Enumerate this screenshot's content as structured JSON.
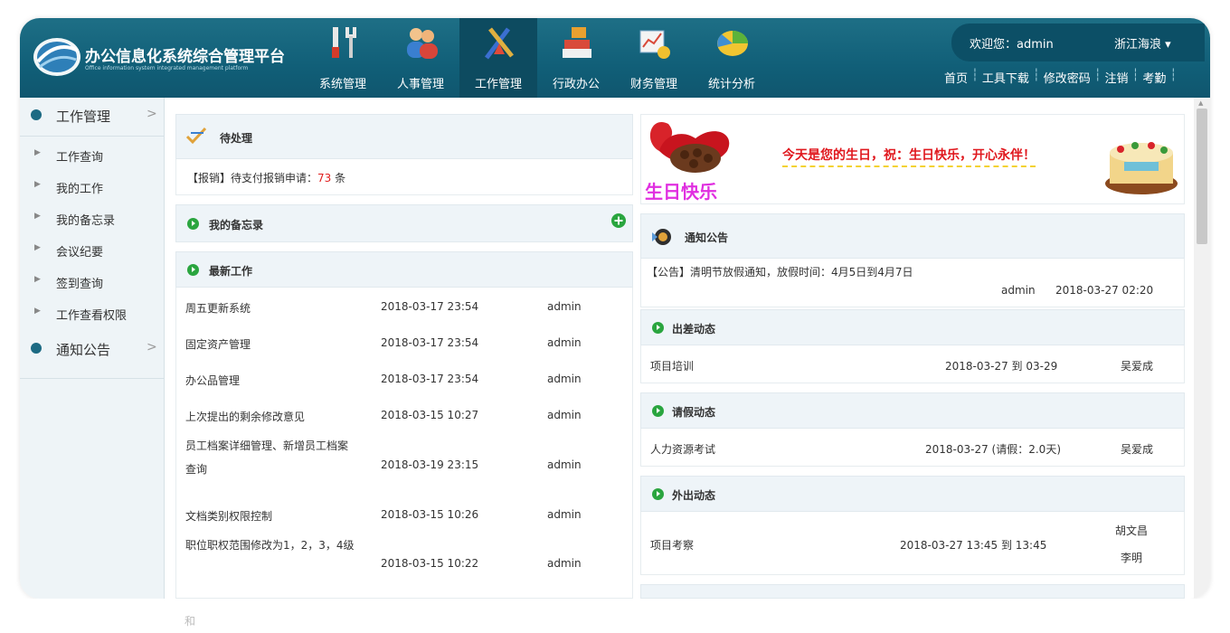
{
  "brand": {
    "title": "办公信息化系统综合管理平台",
    "subtitle": "Office information system integrated management platform"
  },
  "nav": [
    {
      "label": "系统管理",
      "icon": "tools-icon"
    },
    {
      "label": "人事管理",
      "icon": "users-icon"
    },
    {
      "label": "工作管理",
      "icon": "work-tools-icon",
      "active": true
    },
    {
      "label": "行政办公",
      "icon": "office-boxes-icon"
    },
    {
      "label": "财务管理",
      "icon": "finance-chart-icon"
    },
    {
      "label": "统计分析",
      "icon": "pie-chart-icon"
    }
  ],
  "user": {
    "welcome": "欢迎您：admin",
    "region": "浙江海浪 ▾"
  },
  "toplinks": [
    "首页",
    "工具下载",
    "修改密码",
    "注销",
    "考勤"
  ],
  "sidebar": {
    "group1": "工作管理",
    "items": [
      "工作查询",
      "我的工作",
      "我的备忘录",
      "会议纪要",
      "签到查询",
      "工作查看权限"
    ],
    "group2": "通知公告"
  },
  "pending": {
    "title": "待处理",
    "prefix": "【报销】待支付报销申请：",
    "count": "73",
    "suffix": " 条"
  },
  "memo": {
    "title": "我的备忘录"
  },
  "latest": {
    "title": "最新工作",
    "rows": [
      {
        "name": "周五更新系统",
        "time": "2018-03-17 23:54",
        "user": "admin"
      },
      {
        "name": "固定资产管理",
        "time": "2018-03-17 23:54",
        "user": "admin"
      },
      {
        "name": "办公品管理",
        "time": "2018-03-17 23:54",
        "user": "admin"
      },
      {
        "name": "上次提出的剩余修改意见",
        "time": "2018-03-15 10:27",
        "user": "admin"
      },
      {
        "name": "员工档案详细管理、新增员工档案查询",
        "time": "2018-03-19 23:15",
        "user": "admin"
      },
      {
        "name": "文档类别权限控制",
        "time": "2018-03-15 10:26",
        "user": "admin"
      },
      {
        "name": "职位职权范围修改为1，2，3，4级",
        "time": "2018-03-15 10:22",
        "user": "admin"
      }
    ],
    "partial": "和"
  },
  "birthday": {
    "message": "今天是您的生日，祝：生日快乐，开心永伴！",
    "badge": "生日快乐"
  },
  "notice": {
    "title": "通知公告",
    "text": "【公告】清明节放假通知，放假时间：4月5日到4月7日",
    "author": "admin",
    "time": "2018-03-27 02:20"
  },
  "trip": {
    "title": "出差动态",
    "name": "项目培训",
    "time": "2018-03-27 到 03-29",
    "user": "吴爱成"
  },
  "leave": {
    "title": "请假动态",
    "name": "人力资源考试",
    "time": "2018-03-27 (请假：2.0天)",
    "user": "吴爱成"
  },
  "out": {
    "title": "外出动态",
    "name": "项目考察",
    "time": "2018-03-27 13:45 到 13:45",
    "users": [
      "胡文昌",
      "李明"
    ]
  }
}
